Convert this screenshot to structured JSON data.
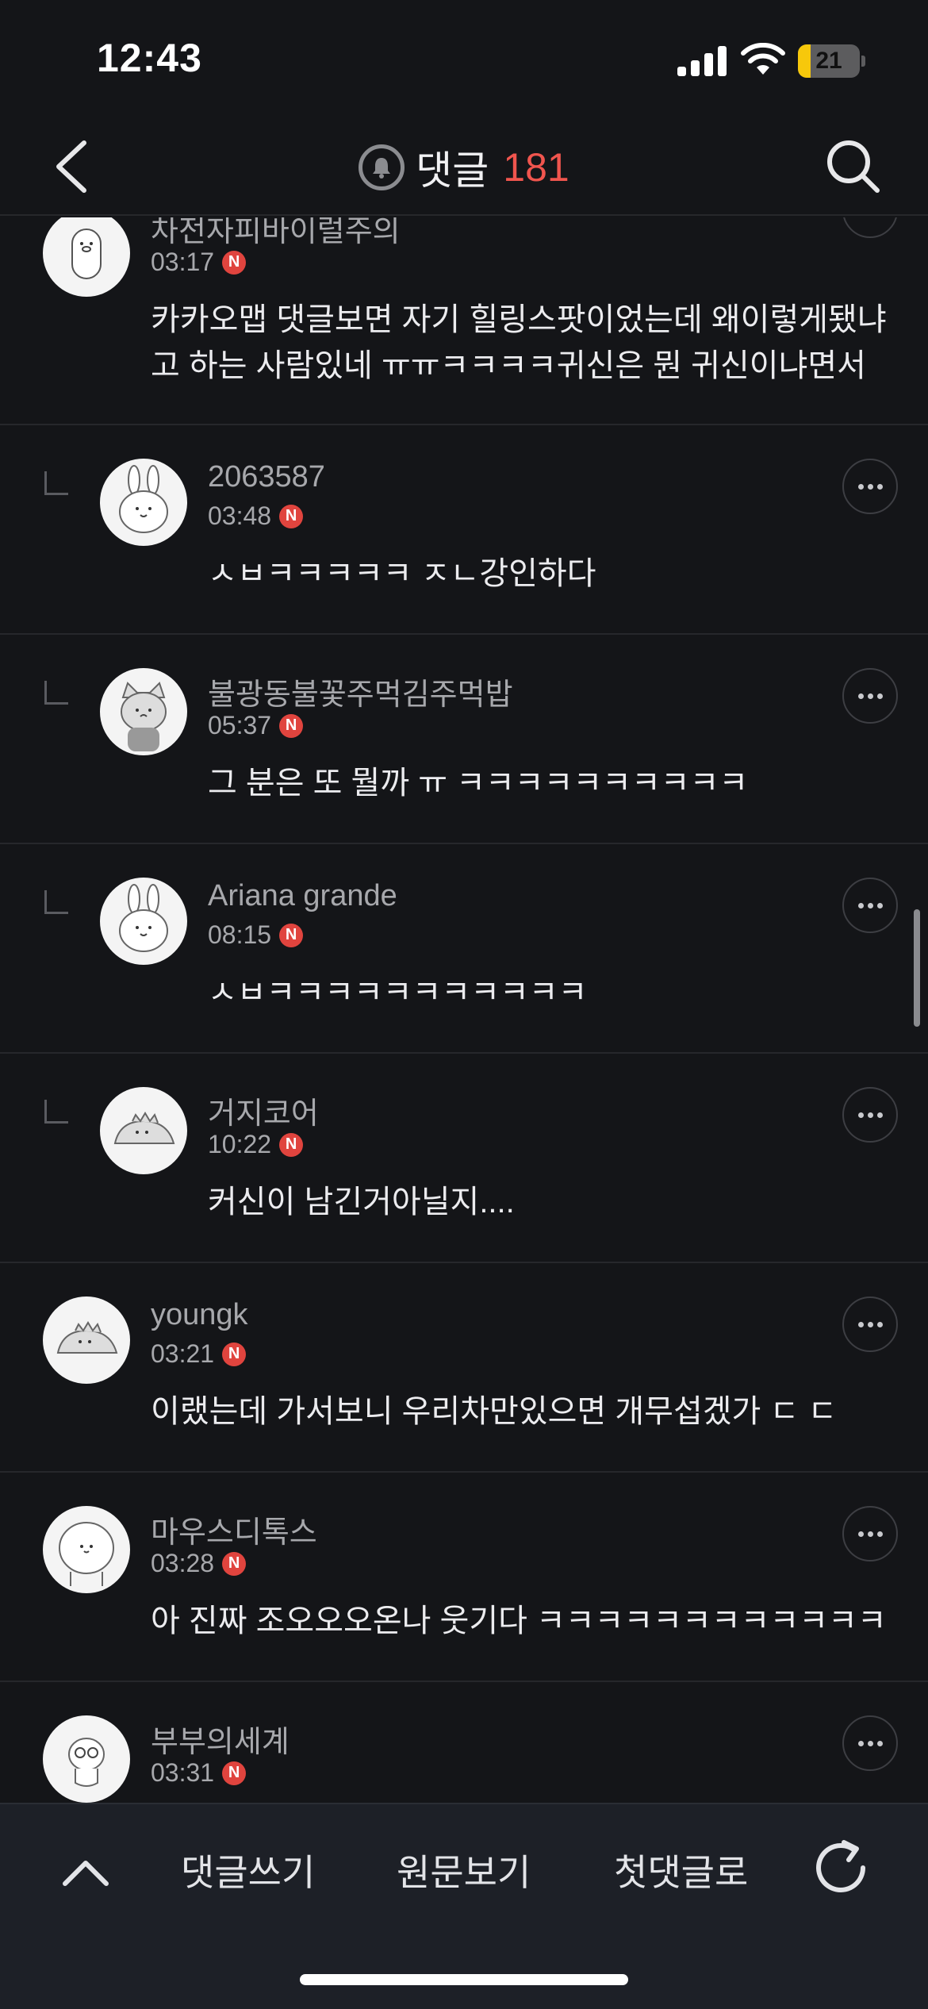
{
  "status_bar": {
    "time": "12:43",
    "battery_level": "21"
  },
  "header": {
    "title": "댓글",
    "count": "181"
  },
  "comments": [
    {
      "name": "차전자피바이럴주의",
      "time": "03:17",
      "badge": "N",
      "text": "카카오맵 댓글보면 자기 힐링스팟이었는데 왜이렇게됐냐\n고 하는 사람있네 ㅠㅠㅋㅋㅋㅋ귀신은 뭔 귀신이냐면서",
      "reply": false
    },
    {
      "name": "2063587",
      "time": "03:48",
      "badge": "N",
      "text": "ㅅㅂㅋㅋㅋㅋㅋ ㅈㄴ강인하다",
      "reply": true
    },
    {
      "name": "불광동불꽃주먹김주먹밥",
      "time": "05:37",
      "badge": "N",
      "text": "그 분은 또 뭘까 ㅠ ㅋㅋㅋㅋㅋㅋㅋㅋㅋㅋ",
      "reply": true
    },
    {
      "name": "Ariana grande",
      "time": "08:15",
      "badge": "N",
      "text": "ㅅㅂㅋㅋㅋㅋㅋㅋㅋㅋㅋㅋㅋ",
      "reply": true
    },
    {
      "name": "거지코어",
      "time": "10:22",
      "badge": "N",
      "text": "커신이 남긴거아닐지....",
      "reply": true
    },
    {
      "name": "youngk",
      "time": "03:21",
      "badge": "N",
      "text": "이랬는데 가서보니 우리차만있으면 개무섭겠가 ㄷ ㄷ",
      "reply": false
    },
    {
      "name": "마우스디톡스",
      "time": "03:28",
      "badge": "N",
      "text": "아 진짜 조오오오온나 웃기다 ㅋㅋㅋㅋㅋㅋㅋㅋㅋㅋㅋㅋ",
      "reply": false
    },
    {
      "name": "부부의세계",
      "time": "03:31",
      "badge": "N",
      "text": "",
      "reply": false
    }
  ],
  "toolbar": {
    "write": "댓글쓰기",
    "original": "원문보기",
    "first": "첫댓글로"
  },
  "icons": {
    "back": "chevron-left-icon",
    "bell": "bell-icon",
    "search": "search-icon",
    "up": "chevron-up-icon",
    "refresh": "refresh-icon",
    "more": "more-icon"
  },
  "colors": {
    "background": "#141518",
    "accent": "#f0554e",
    "badge": "#e0443e",
    "toolbar": "#1d2027"
  }
}
